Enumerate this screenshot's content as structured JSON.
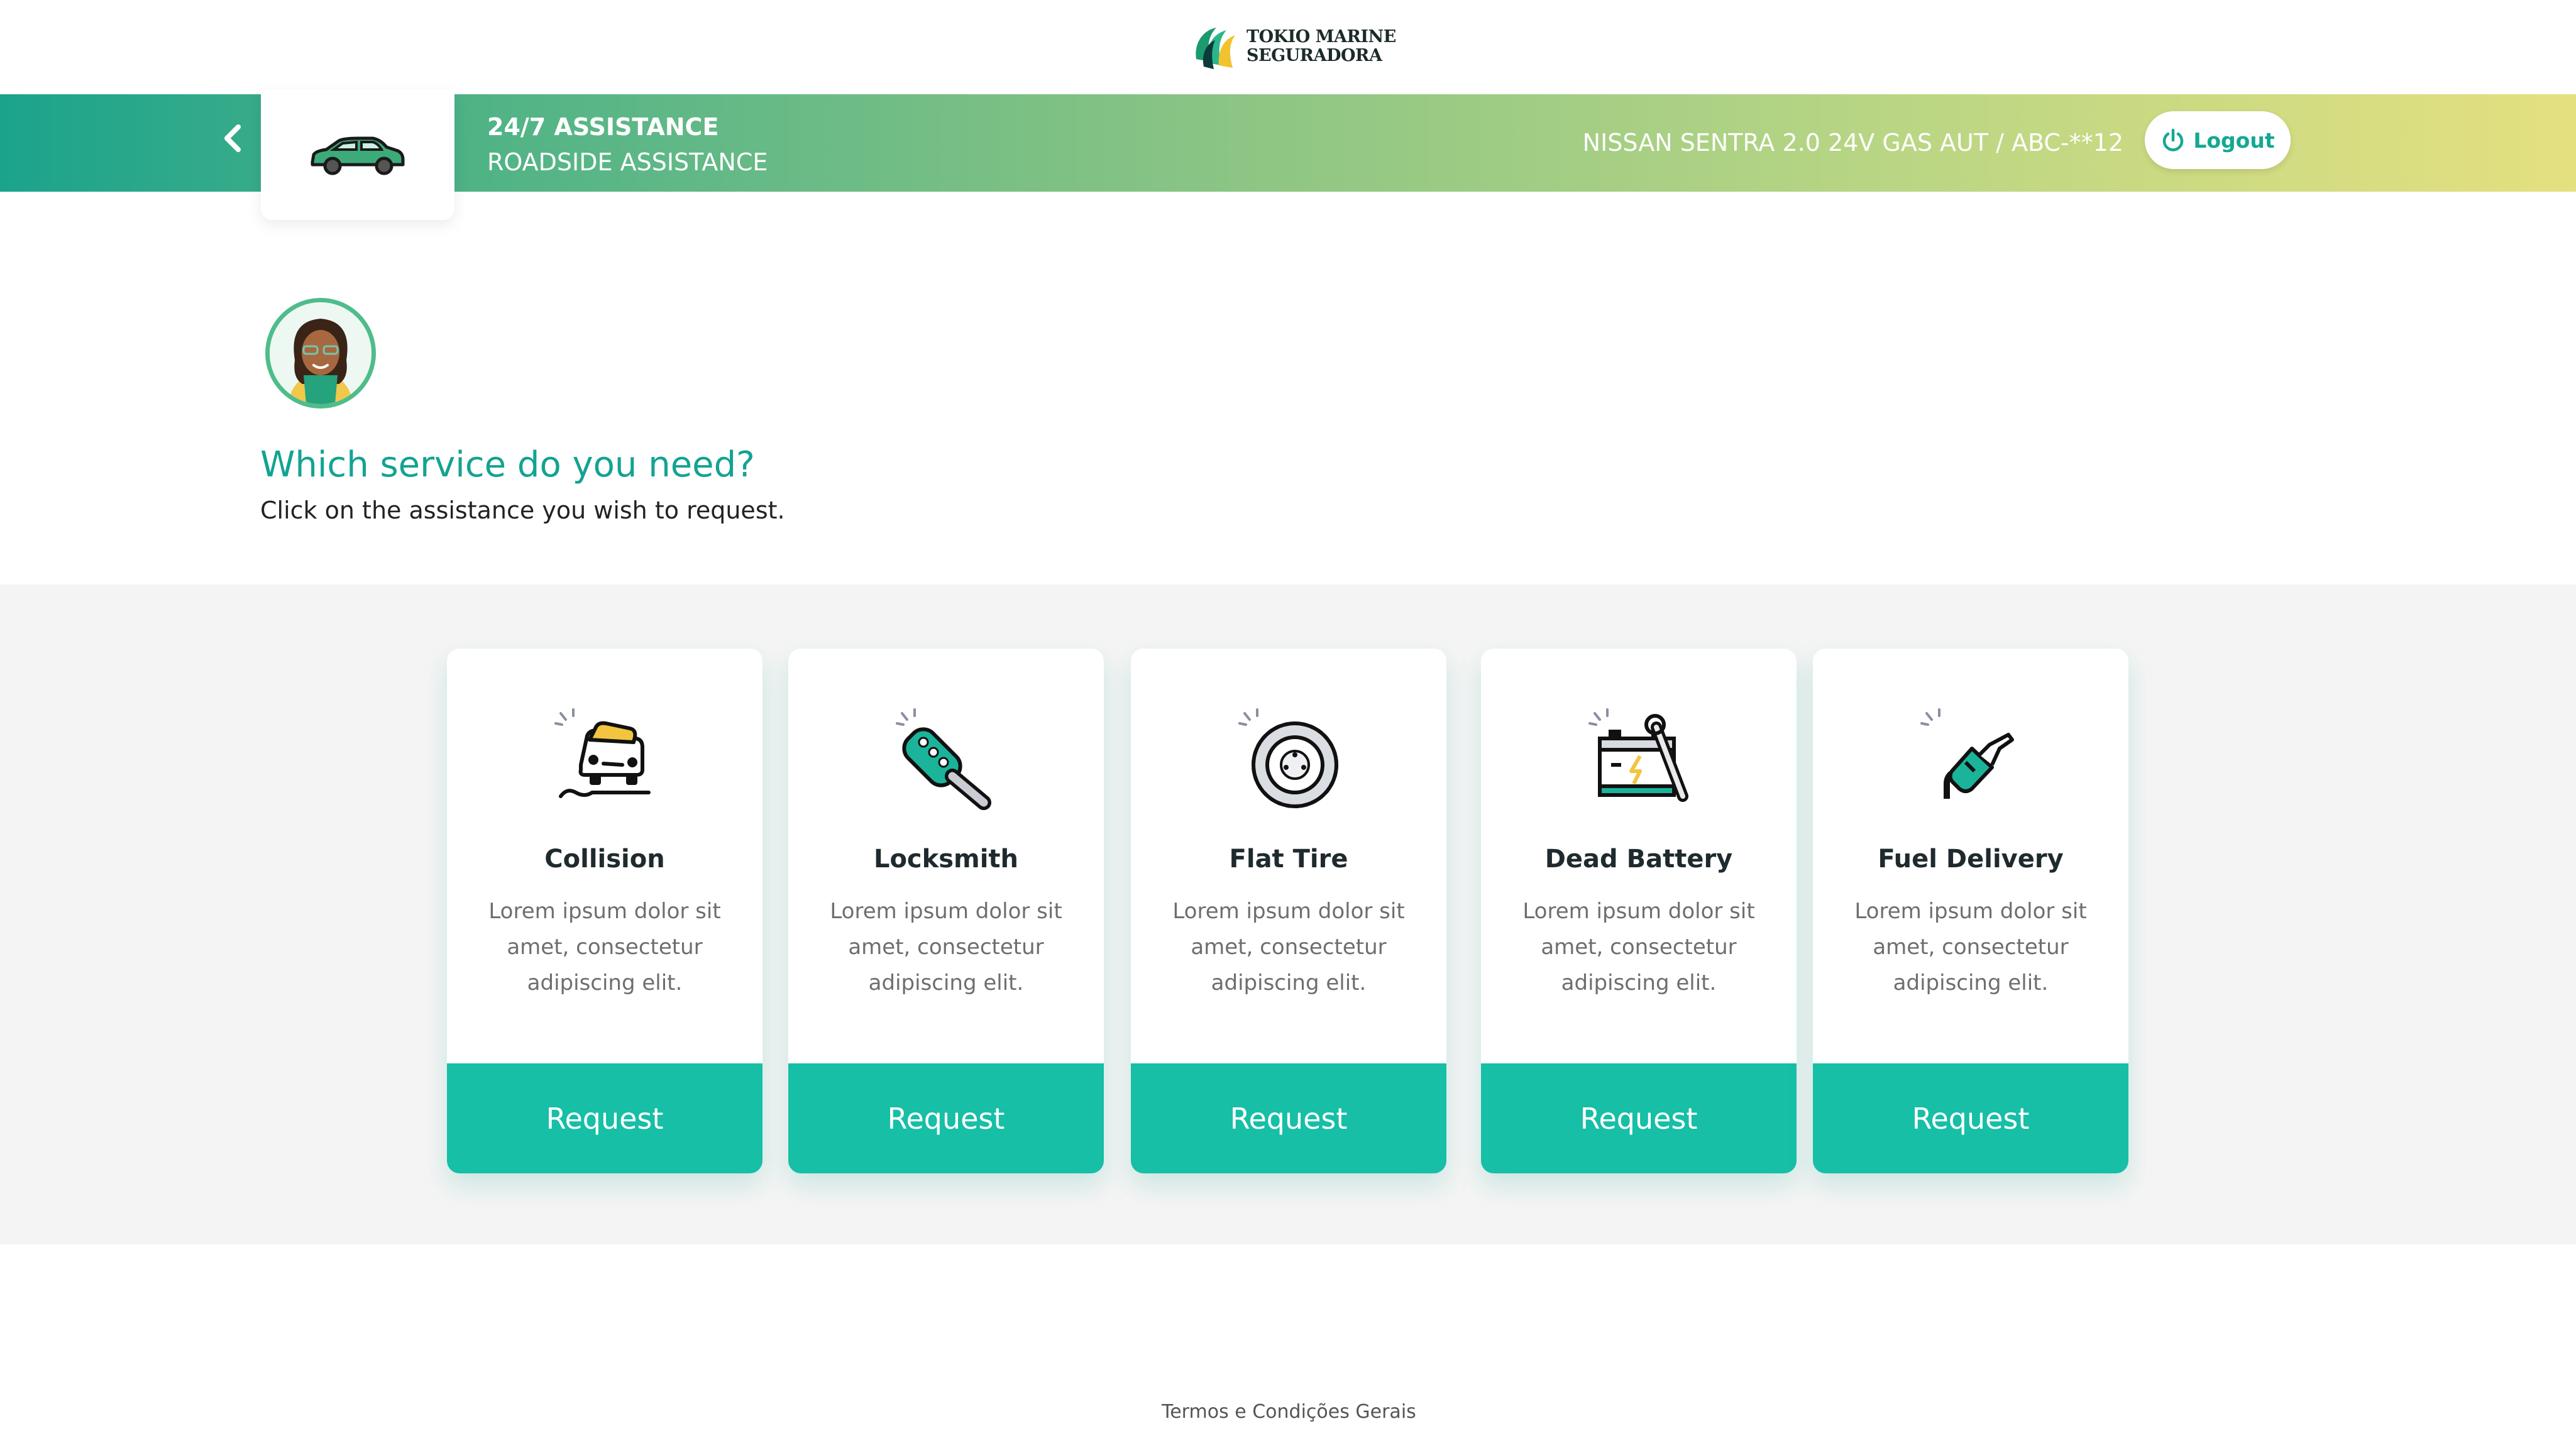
{
  "brand": {
    "line1": "TOKIO MARINE",
    "line2": "SEGURADORA"
  },
  "header": {
    "title": "24/7 ASSISTANCE",
    "subtitle": "ROADSIDE ASSISTANCE",
    "vehicle": "NISSAN SENTRA 2.0 24V  GAS  AUT / ABC-**12",
    "logout_label": "Logout"
  },
  "intro": {
    "question": "Which service do you need?",
    "instruction": "Click on the assistance you wish to request."
  },
  "services": [
    {
      "icon": "collision-icon",
      "title": "Collision",
      "description": "Lorem ipsum dolor sit amet, consectetur adipiscing elit.",
      "button": "Request"
    },
    {
      "icon": "locksmith-icon",
      "title": "Locksmith",
      "description": "Lorem ipsum dolor sit amet, consectetur adipiscing elit.",
      "button": "Request"
    },
    {
      "icon": "flat-tire-icon",
      "title": "Flat Tire",
      "description": "Lorem ipsum dolor sit amet, consectetur adipiscing elit.",
      "button": "Request"
    },
    {
      "icon": "dead-battery-icon",
      "title": "Dead Battery",
      "description": "Lorem ipsum dolor sit amet, consectetur adipiscing elit.",
      "button": "Request"
    },
    {
      "icon": "fuel-delivery-icon",
      "title": "Fuel Delivery",
      "description": "Lorem ipsum dolor sit amet, consectetur adipiscing elit.",
      "button": "Request"
    }
  ],
  "footer": {
    "terms": "Termos e Condições Gerais"
  },
  "colors": {
    "accent": "#16bfa6",
    "title_teal": "#13a392",
    "header_start": "#1ba38c",
    "header_end": "#e4e080"
  }
}
